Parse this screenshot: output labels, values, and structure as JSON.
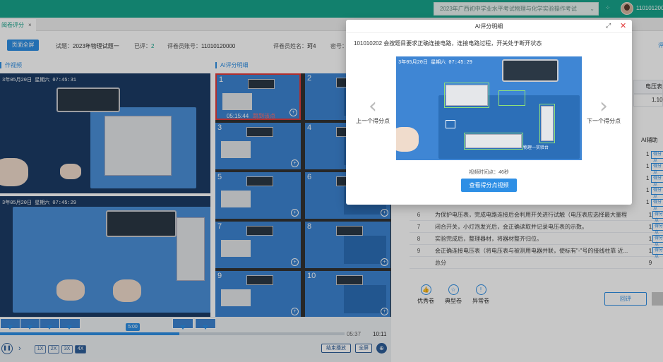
{
  "topbar": {
    "exam_select": "2023年广西初中学业水平考试物理与化学实验操作考试",
    "user_id": "1101012000"
  },
  "tabs": [
    {
      "label": "阅卷评分",
      "close": "×"
    }
  ],
  "info": {
    "fullscreen_button": "页面全屏",
    "exam_label": "试题：",
    "exam_value": "2023年物理试题一",
    "graded_label": "已评：",
    "graded_value": "2",
    "grader_account_label": "评卷员账号：",
    "grader_account_value": "11010120000",
    "grader_name_label": "评卷员姓名：",
    "grader_name_value": "珂4",
    "password_label": "密号："
  },
  "left": {
    "video_title": "作视频",
    "video1_overlay": "3年05月20日 星期六 07:45:31",
    "video2_overlay": "3年05月20日 星期六 07:45:29"
  },
  "ai_panel": {
    "title": "AI评分明细",
    "thumbs": [
      {
        "n": "1",
        "time": "05:15:44",
        "jump": "跳到该点"
      },
      {
        "n": "2"
      },
      {
        "n": "3"
      },
      {
        "n": "4"
      },
      {
        "n": "5"
      },
      {
        "n": "6"
      },
      {
        "n": "7"
      },
      {
        "n": "8"
      },
      {
        "n": "9"
      },
      {
        "n": "10"
      }
    ]
  },
  "timeline": {
    "bubble": "5:00",
    "current": "05:37",
    "total": "10:11",
    "progress": 0.52,
    "speeds": [
      "1X",
      "2X",
      "3X",
      "4X"
    ],
    "active_speed": "4X",
    "end_play": "结束播放",
    "fullscreen": "全屏"
  },
  "right": {
    "voltage_header": "电压表",
    "voltage_value": "1.10",
    "ai_assist_header": "AI辅助",
    "rows": [
      {
        "idx": "6",
        "desc": "为保护电压表，完成电路连接后会利用开关进行试触（电压表应选择最大量程",
        "score": "1",
        "tag": "得分点"
      },
      {
        "idx": "7",
        "desc": "闭合开关，小灯泡发光后，会正确读取并记录电压表的示数。",
        "score": "1",
        "tag": "得分点"
      },
      {
        "idx": "8",
        "desc": "实验完成后，整理器材，将器材整齐归位。",
        "score": "1",
        "tag": "得分点"
      },
      {
        "idx": "9",
        "desc": "会正确连接电压表（将电压表与被测用电器并联，使标有\"-\"号的接线柱靠 近...",
        "score": "1",
        "tag": "得分点"
      },
      {
        "idx": "",
        "desc": "总分",
        "score": "9",
        "tag": ""
      }
    ],
    "ai_col": [
      {
        "score": "1",
        "tag": "得分点"
      },
      {
        "score": "1",
        "tag": "得分点"
      },
      {
        "score": "1",
        "tag": "得分点"
      },
      {
        "score": "1",
        "tag": "得分点"
      },
      {
        "score": "1",
        "tag": "得分点"
      }
    ],
    "actions": [
      {
        "icon": "thumb-up-icon",
        "label": "优秀卷"
      },
      {
        "icon": "star-icon",
        "label": "典型卷"
      },
      {
        "icon": "alert-icon",
        "label": "异常卷"
      }
    ],
    "back_button": "回评"
  },
  "modal": {
    "title": "AI评分明细",
    "question": "101010202 会按题目要求正确连接电路，连接电路过程，开关处于断开状态",
    "image_overlay": "3年05月20日 星期六 07:45:29",
    "image_label": "物理一实验台",
    "prev_label": "上一个得分点",
    "next_label": "下一个得分点",
    "video_time": "视频时间点：46秒",
    "view_button": "查看得分点视频"
  },
  "colors": {
    "accent": "#18a58c",
    "primary": "#2e8fe5",
    "danger": "#e23c3c"
  }
}
